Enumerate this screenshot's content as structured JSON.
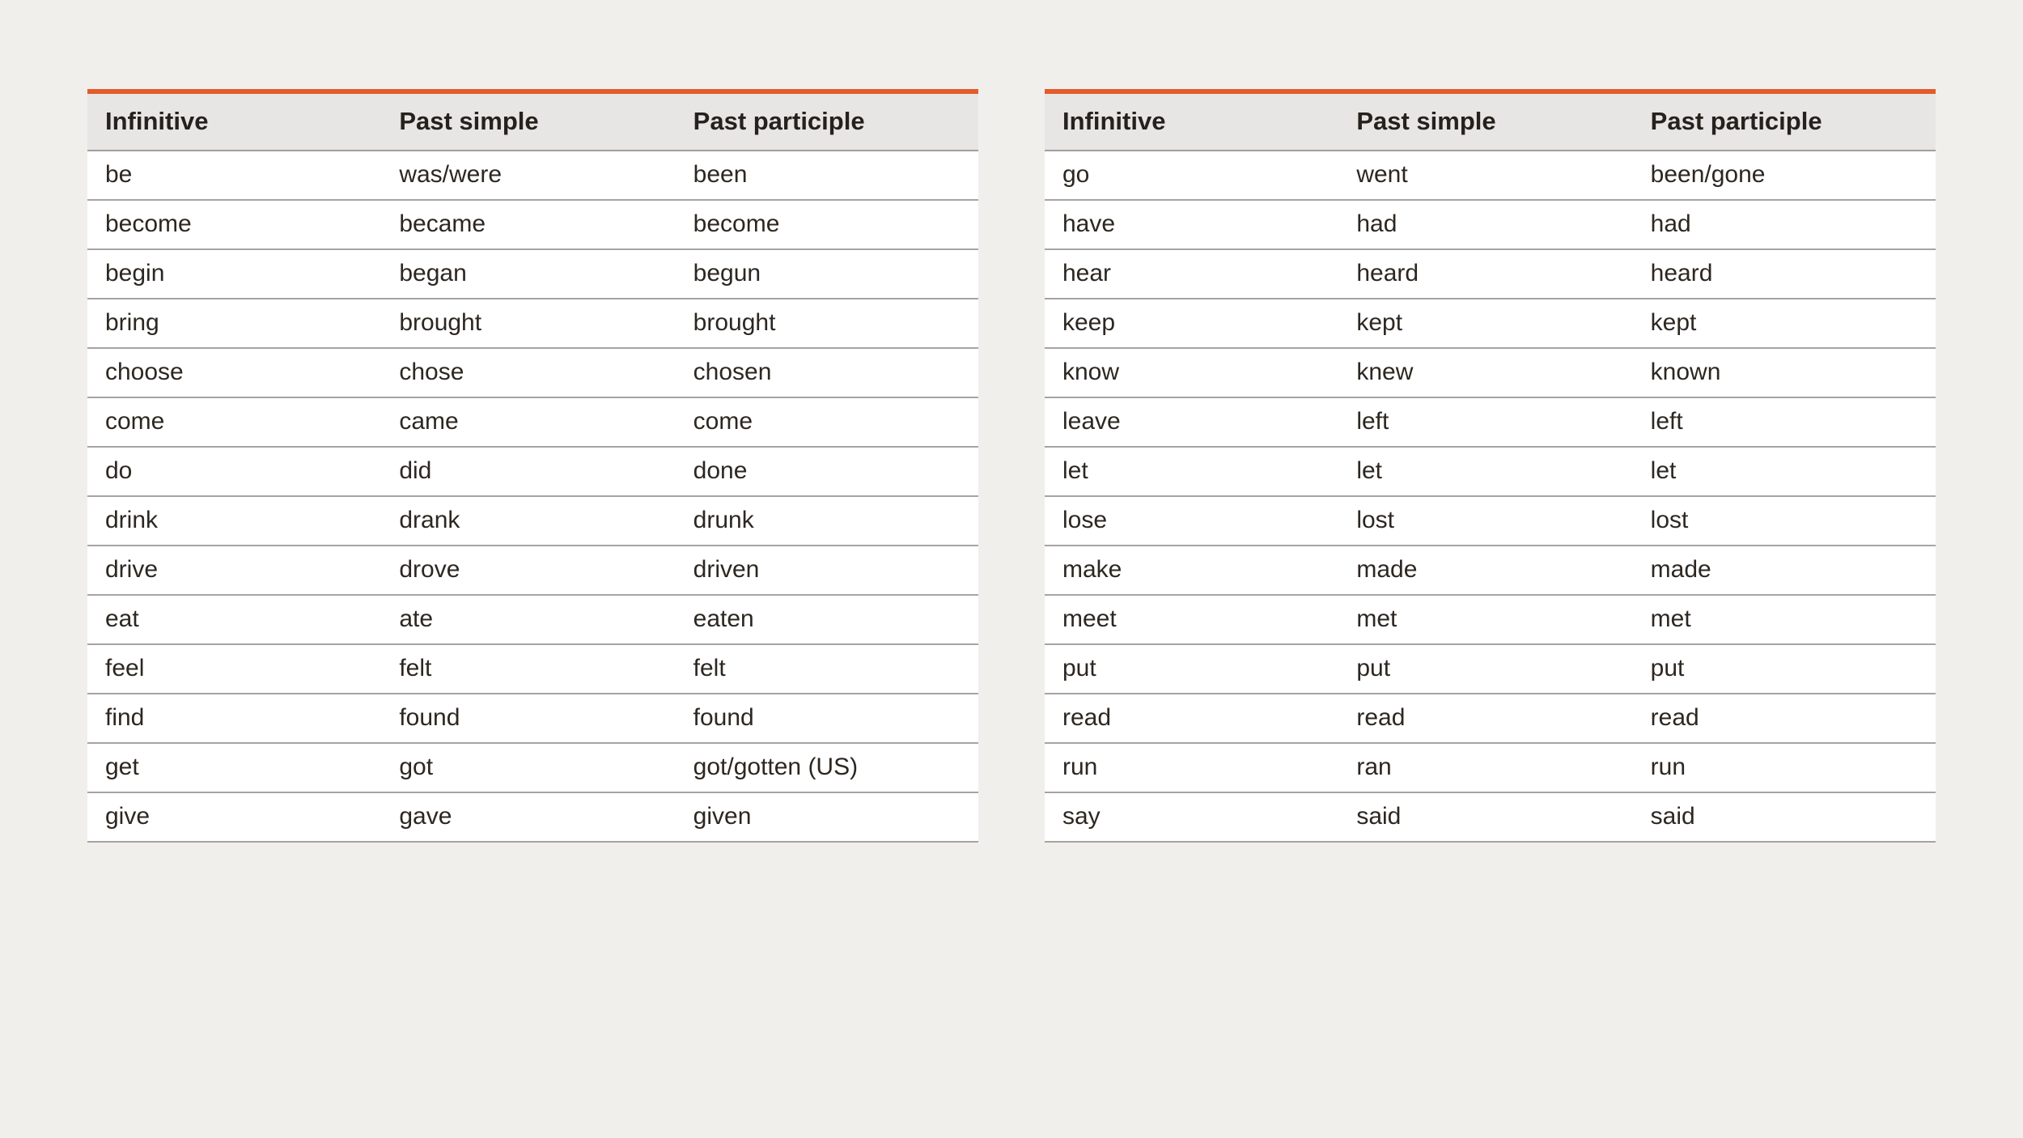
{
  "columns": [
    "Infinitive",
    "Past simple",
    "Past participle"
  ],
  "tables": [
    {
      "rows": [
        [
          "be",
          "was/were",
          "been"
        ],
        [
          "become",
          "became",
          "become"
        ],
        [
          "begin",
          "began",
          "begun"
        ],
        [
          "bring",
          "brought",
          "brought"
        ],
        [
          "choose",
          "chose",
          "chosen"
        ],
        [
          "come",
          "came",
          "come"
        ],
        [
          "do",
          "did",
          "done"
        ],
        [
          "drink",
          "drank",
          "drunk"
        ],
        [
          "drive",
          "drove",
          "driven"
        ],
        [
          "eat",
          "ate",
          "eaten"
        ],
        [
          "feel",
          "felt",
          "felt"
        ],
        [
          "find",
          "found",
          "found"
        ],
        [
          "get",
          "got",
          "got/gotten (US)"
        ],
        [
          "give",
          "gave",
          "given"
        ]
      ]
    },
    {
      "rows": [
        [
          "go",
          "went",
          "been/gone"
        ],
        [
          "have",
          "had",
          "had"
        ],
        [
          "hear",
          "heard",
          "heard"
        ],
        [
          "keep",
          "kept",
          "kept"
        ],
        [
          "know",
          "knew",
          "known"
        ],
        [
          "leave",
          "left",
          "left"
        ],
        [
          "let",
          "let",
          "let"
        ],
        [
          "lose",
          "lost",
          "lost"
        ],
        [
          "make",
          "made",
          "made"
        ],
        [
          "meet",
          "met",
          "met"
        ],
        [
          "put",
          "put",
          "put"
        ],
        [
          "read",
          "read",
          "read"
        ],
        [
          "run",
          "ran",
          "run"
        ],
        [
          "say",
          "said",
          "said"
        ]
      ]
    }
  ],
  "colors": {
    "accent": "#e35c2c",
    "headerBg": "#e7e6e4",
    "border": "#a6a4a1",
    "pageBg": "#f0efec",
    "rowBg": "#ffffff",
    "text": "#26211c"
  }
}
